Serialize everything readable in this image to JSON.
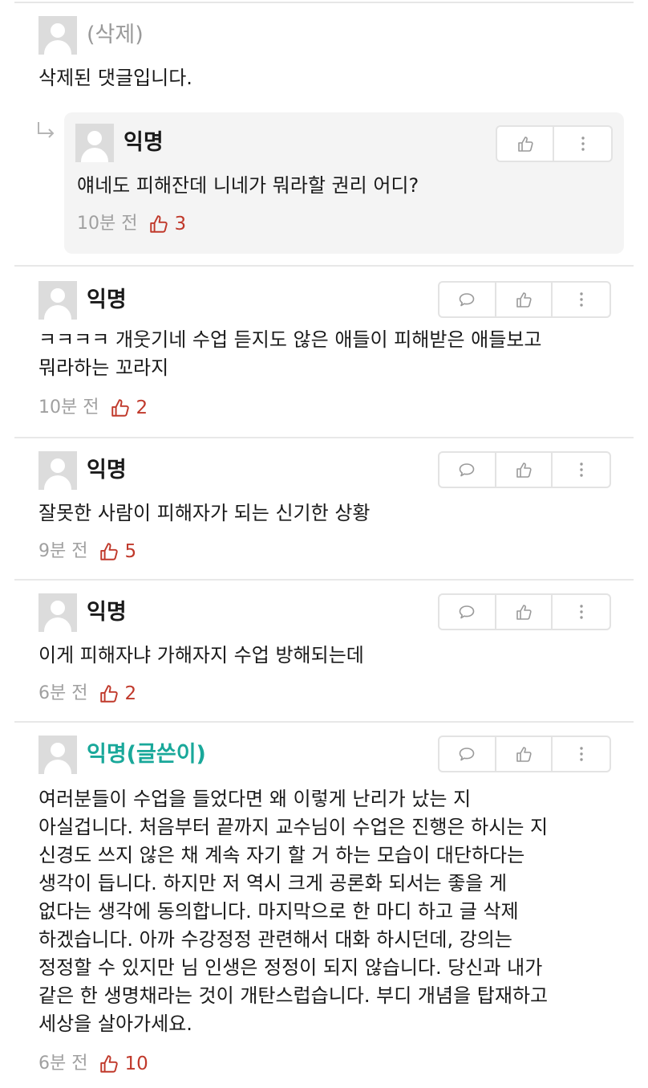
{
  "comments": [
    {
      "author": "(삭제)",
      "text": "삭제된 댓글입니다.",
      "replies": [
        {
          "author": "익명",
          "text": "얘네도 피해잔데 니네가 뭐라할 권리 어디?",
          "time": "10분 전",
          "likes": "3"
        }
      ]
    },
    {
      "author": "익명",
      "text": "ㅋㅋㅋㅋ 개웃기네 수업 듣지도 않은 애들이 피해받은 애들보고\n뭐라하는 꼬라지",
      "time": "10분 전",
      "likes": "2"
    },
    {
      "author": "익명",
      "text": "잘못한 사람이 피해자가 되는 신기한 상황",
      "time": "9분 전",
      "likes": "5"
    },
    {
      "author": "익명",
      "text": "이게 피해자냐 가해자지 수업 방해되는데",
      "time": "6분 전",
      "likes": "2"
    },
    {
      "author": "익명(글쓴이)",
      "text": "여러분들이 수업을 들었다면 왜 이렇게 난리가 났는 지\n아실겁니다. 처음부터 끝까지 교수님이 수업은 진행은 하시는 지\n신경도 쓰지 않은 채 계속 자기 할 거 하는 모습이 대단하다는\n생각이 듭니다. 하지만 저 역시 크게 공론화 되서는 좋을 게\n없다는 생각에 동의합니다. 마지막으로 한 마디 하고 글 삭제\n하겠습니다. 아까 수강정정 관련해서 대화 하시던데, 강의는\n정정할 수 있지만 님 인생은 정정이 되지 않습니다. 당신과 내가\n같은 한 생명채라는 것이 개탄스럽습니다. 부디 개념을 탑재하고\n세상을 살아가세요.",
      "time": "6분 전",
      "likes": "10"
    }
  ],
  "icons": {
    "reply": "comment-bubble-icon",
    "like": "thumbs-up-icon",
    "more": "more-vertical-icon",
    "reply_arrow": "reply-arrow-icon"
  },
  "colors": {
    "writer": "#19a89a",
    "likes": "#c0392b",
    "muted": "#a0a0a0"
  }
}
